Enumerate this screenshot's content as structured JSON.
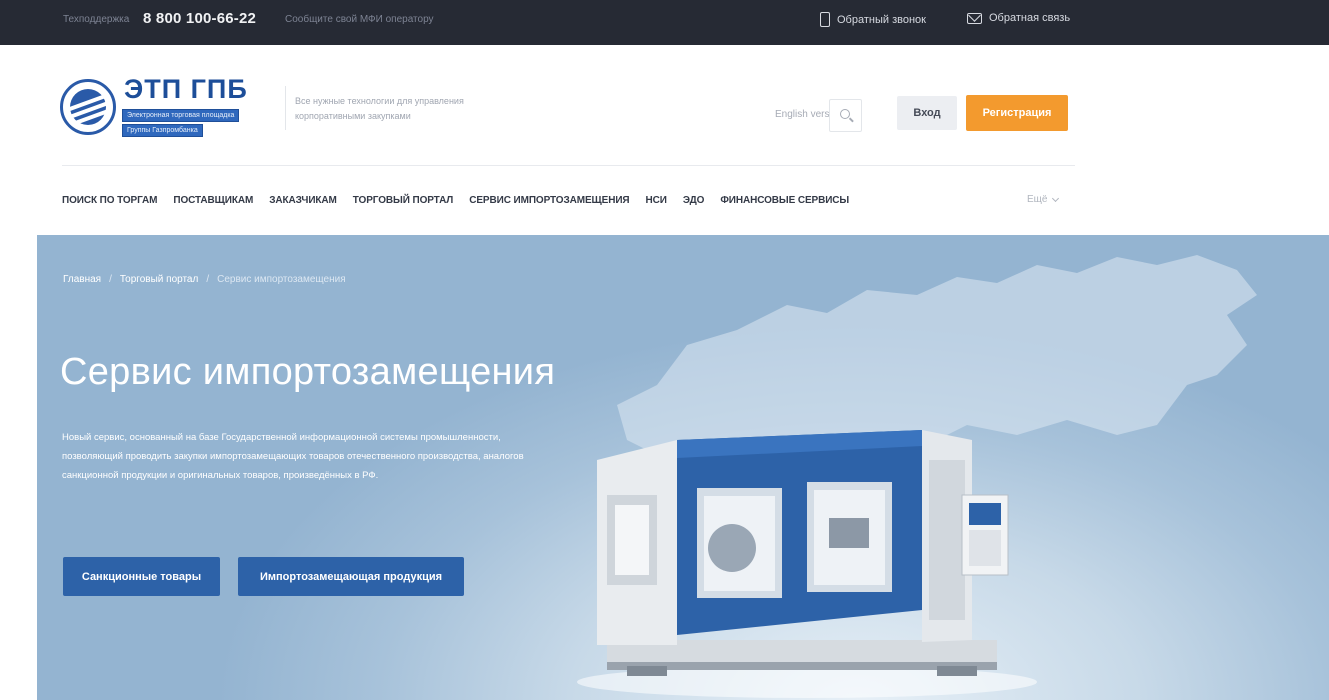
{
  "topbar": {
    "support_label": "Техподдержка",
    "phone": "8 800 100-66-22",
    "mfi_text": "Сообщите свой МФИ оператору",
    "callback_label": "Обратный звонок",
    "feedback_label": "Обратная связь"
  },
  "header": {
    "logo_title": "ЭТП ГПБ",
    "logo_tag_1": "Электронная торговая площадка",
    "logo_tag_2": "Группы Газпромбанка",
    "description": "Все нужные технологии для управления корпоративными закупками",
    "english_link": "English version",
    "login_label": "Вход",
    "register_label": "Регистрация"
  },
  "nav": {
    "items": [
      "ПОИСК ПО ТОРГАМ",
      "ПОСТАВЩИКАМ",
      "ЗАКАЗЧИКАМ",
      "ТОРГОВЫЙ ПОРТАЛ",
      "СЕРВИС ИМПОРТОЗАМЕЩЕНИЯ",
      "НСИ",
      "ЭДО",
      "ФИНАНСОВЫЕ СЕРВИСЫ"
    ],
    "more_label": "Ещё"
  },
  "hero": {
    "breadcrumb": [
      "Главная",
      "Торговый портал",
      "Сервис импортозамещения"
    ],
    "title": "Сервис импортозамещения",
    "description": "Новый сервис, основанный на базе Государственной информационной системы промышленности, позволяющий проводить закупки импортозамещающих товаров отечественного производства, аналогов санкционной продукции и оригинальных товаров, произведённых в РФ.",
    "button_sanction": "Санкционные товары",
    "button_import": "Импортозамещающая продукция"
  },
  "colors": {
    "topbar_bg": "#262a34",
    "brand_blue": "#2d62a8",
    "register_orange": "#f39a2e",
    "hero_bg": "#a7c2da"
  }
}
